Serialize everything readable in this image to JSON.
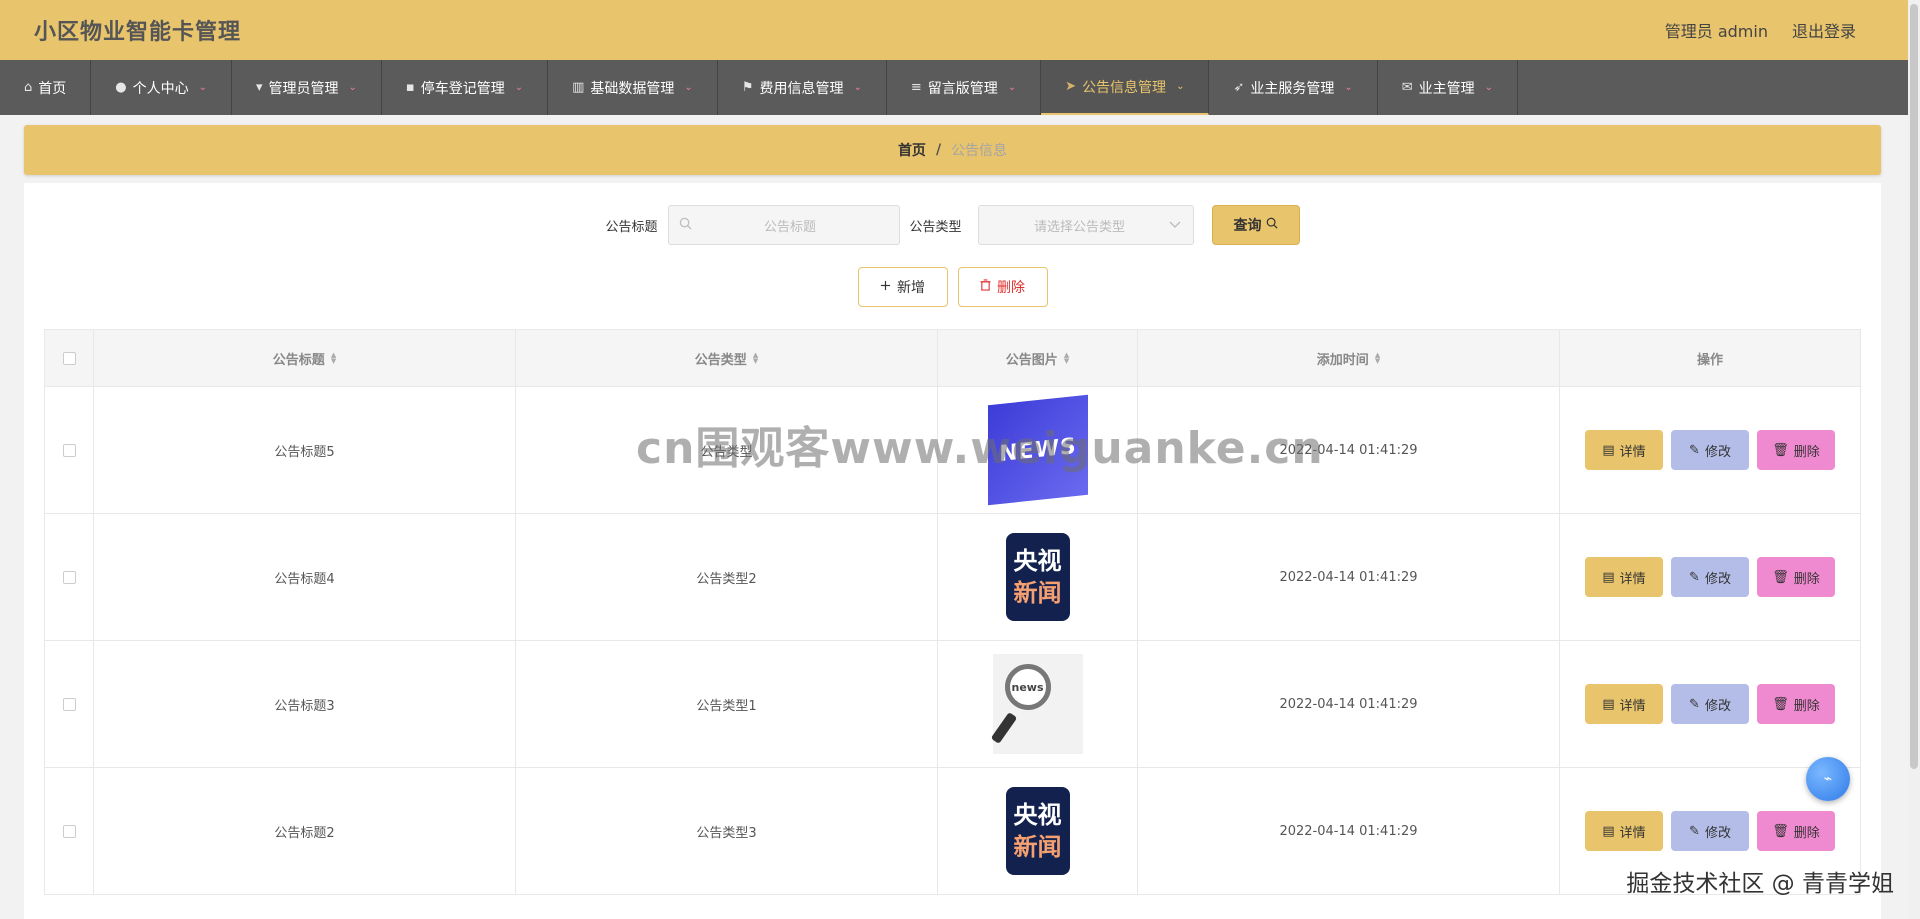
{
  "header": {
    "title": "小区物业智能卡管理",
    "user": "管理员 admin",
    "logout": "退出登录"
  },
  "nav": [
    {
      "label": "首页",
      "icon": "home-icon",
      "glyph": "⌂",
      "caret": ""
    },
    {
      "label": "个人中心",
      "icon": "user-icon",
      "glyph": "●",
      "caret": "⌄"
    },
    {
      "label": "管理员管理",
      "icon": "stamp-icon",
      "glyph": "▾",
      "caret": "⌄"
    },
    {
      "label": "停车登记管理",
      "icon": "chat-icon",
      "glyph": "▪",
      "caret": "⌄"
    },
    {
      "label": "基础数据管理",
      "icon": "bar-chart-icon",
      "glyph": "▥",
      "caret": "⌄"
    },
    {
      "label": "费用信息管理",
      "icon": "flag-icon",
      "glyph": "⚑",
      "caret": "⌄"
    },
    {
      "label": "留言版管理",
      "icon": "menu-icon",
      "glyph": "≡",
      "caret": "⌄"
    },
    {
      "label": "公告信息管理",
      "icon": "send-icon",
      "glyph": "➤",
      "caret": "⌄",
      "active": true
    },
    {
      "label": "业主服务管理",
      "icon": "navigation-icon",
      "glyph": "➶",
      "caret": "⌄"
    },
    {
      "label": "业主管理",
      "icon": "mail-icon",
      "glyph": "✉",
      "caret": "⌄"
    }
  ],
  "breadcrumb": {
    "home": "首页",
    "separator": "/",
    "current": "公告信息"
  },
  "search": {
    "title_label": "公告标题",
    "title_placeholder": "公告标题",
    "type_label": "公告类型",
    "type_placeholder": "请选择公告类型",
    "query_button": "查询"
  },
  "actions": {
    "add": "新增",
    "delete": "删除"
  },
  "table": {
    "headers": {
      "title": "公告标题",
      "type": "公告类型",
      "image": "公告图片",
      "time": "添加时间",
      "ops": "操作"
    },
    "rows": [
      {
        "title": "公告标题5",
        "type": "公告类型",
        "image": "news",
        "time": "2022-04-14 01:41:29"
      },
      {
        "title": "公告标题4",
        "type": "公告类型2",
        "image": "cctv",
        "time": "2022-04-14 01:41:29"
      },
      {
        "title": "公告标题3",
        "type": "公告类型1",
        "image": "glass",
        "time": "2022-04-14 01:41:29"
      },
      {
        "title": "公告标题2",
        "type": "公告类型3",
        "image": "cctv",
        "time": "2022-04-14 01:41:29"
      }
    ],
    "op_labels": {
      "detail": "详情",
      "edit": "修改",
      "delete": "删除"
    }
  },
  "image_text": {
    "news": "NEWS",
    "cctv_top": "央视",
    "cctv_bottom": "新闻",
    "glass": "news"
  },
  "watermark": "cn围观客www.weiguanke.cn",
  "footer_mark": "掘金技术社区 @ 青青学姐",
  "colors": {
    "accent": "#e8c46c",
    "nav_bg": "#5b5b5b",
    "edit": "#b3bde8",
    "delete": "#f08ad0"
  }
}
